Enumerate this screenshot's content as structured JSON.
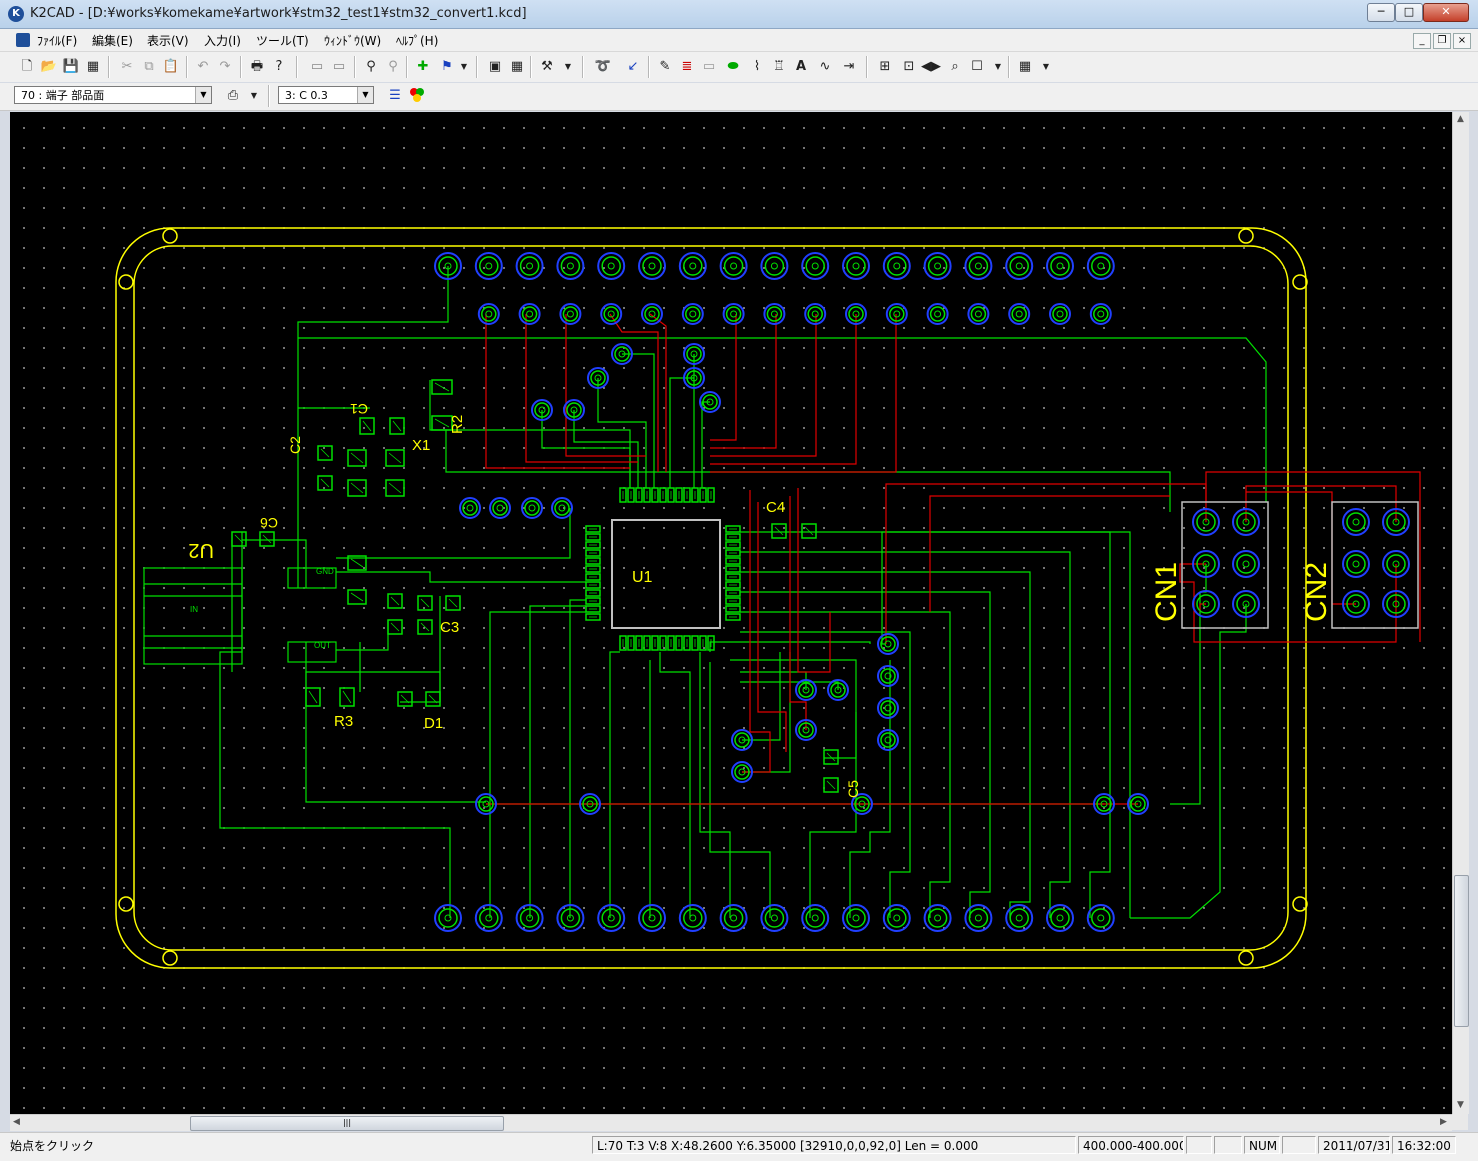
{
  "window": {
    "app_icon": "K",
    "title": "K2CAD - [D:¥works¥komekame¥artwork¥stm32_test1¥stm32_convert1.kcd]",
    "minimize": "─",
    "maximize": "□",
    "close": "✕"
  },
  "menu": {
    "items": [
      "ﾌｧｲﾙ(F)",
      "編集(E)",
      "表示(V)",
      "入力(I)",
      "ツール(T)",
      "ｳｨﾝﾄﾞｳ(W)",
      "ﾍﾙﾌﾟ(H)"
    ],
    "mdi_min": "_",
    "mdi_restore": "❐",
    "mdi_close": "×"
  },
  "toolbar2": {
    "layer_select": "70 : 端子  部品面",
    "width_select": "3: C 0.3"
  },
  "pcb": {
    "labels": {
      "c1": "C1",
      "c2": "C2",
      "r2": "R2",
      "x1": "X1",
      "c6": "C6",
      "u2": "U2",
      "c4": "C4",
      "u1": "U1",
      "c3": "C3",
      "r3": "R3",
      "d1": "D1",
      "c5": "C5",
      "cn1": "CN1",
      "cn2": "CN2",
      "in_pin": "IN",
      "gnd_pin": "GND",
      "out_pin": "OUT"
    },
    "colors": {
      "board_outline": "#ffff00",
      "trace_top": "#00e000",
      "trace_bottom": "#e00000",
      "pad_ring": "#2040ff",
      "background": "#000000"
    }
  },
  "status": {
    "prompt": "始点をクリック",
    "coords": "L:70 T:3 V:8 X:48.2600 Y:6.35000 [32910,0,0,92,0] Len = 0.000",
    "grid": "400.000-400.000",
    "num": "NUM",
    "date": "2011/07/31",
    "time": "16:32:00"
  }
}
